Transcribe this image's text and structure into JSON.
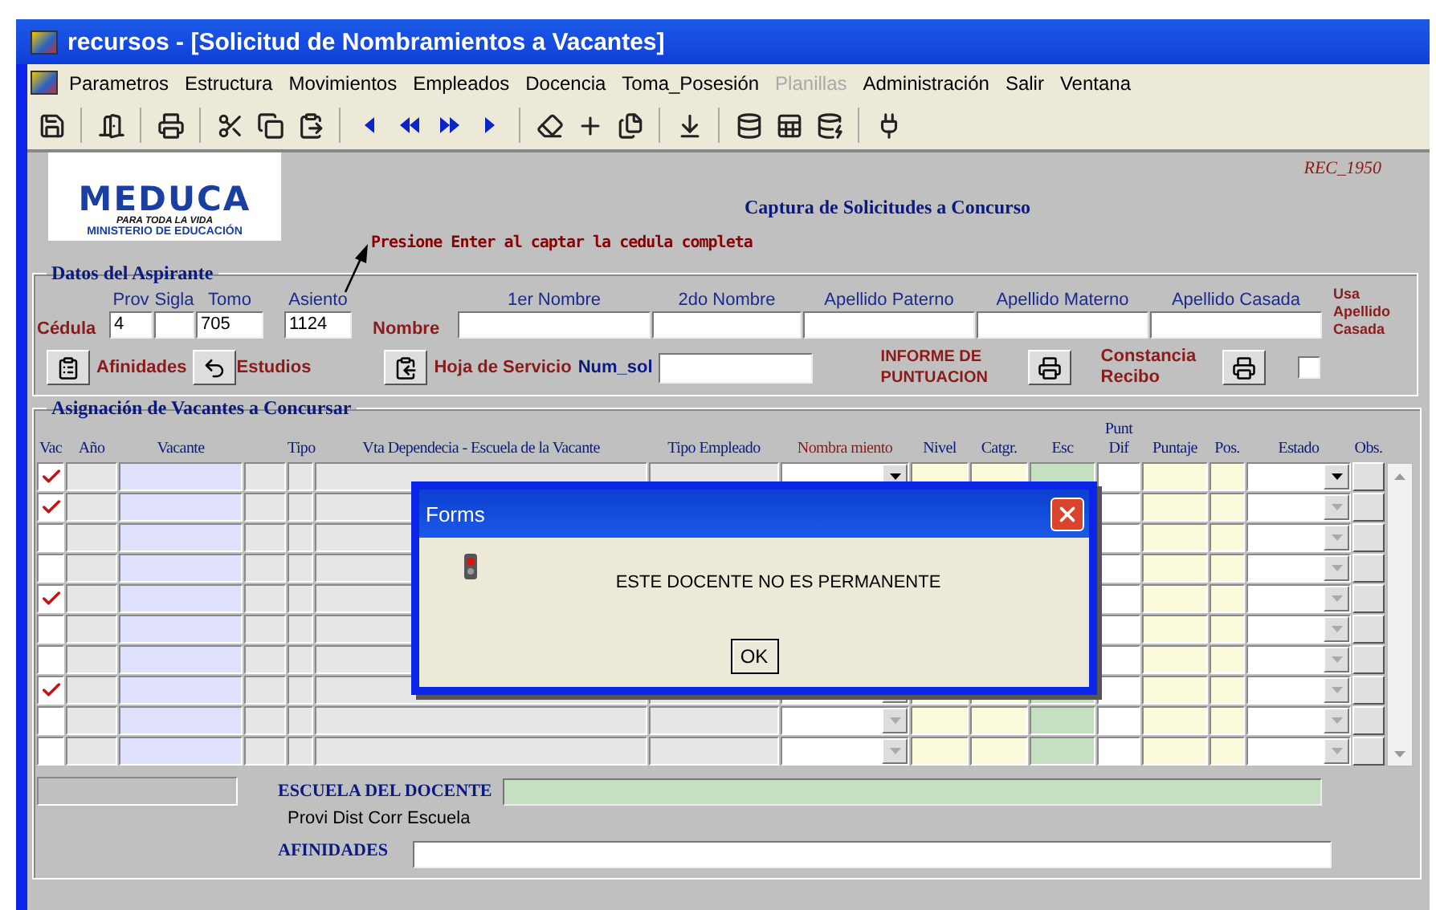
{
  "window": {
    "title": "recursos - [Solicitud de Nombramientos a Vacantes]"
  },
  "menu": [
    {
      "label": "Parametros",
      "disabled": false
    },
    {
      "label": "Estructura",
      "disabled": false
    },
    {
      "label": "Movimientos",
      "disabled": false
    },
    {
      "label": "Empleados",
      "disabled": false
    },
    {
      "label": "Docencia",
      "disabled": false
    },
    {
      "label": "Toma_Posesión",
      "disabled": false
    },
    {
      "label": "Planillas",
      "disabled": true
    },
    {
      "label": "Administración",
      "disabled": false
    },
    {
      "label": "Salir",
      "disabled": false
    },
    {
      "label": "Ventana",
      "disabled": false
    }
  ],
  "header": {
    "code": "REC_1950",
    "title": "Captura de Solicitudes a Concurso",
    "hint": "Presione Enter al captar la cedula completa",
    "logo": {
      "name": "MEDUCA",
      "tagline": "PARA TODA LA VIDA",
      "ministry": "MINISTERIO DE EDUCACIÓN"
    }
  },
  "aspirante": {
    "legend": "Datos del Aspirante",
    "cedula_label": "Cédula",
    "cedula": [
      {
        "label": "Prov",
        "value": "4"
      },
      {
        "label": "Sigla"
      },
      {
        "label": "Tomo",
        "value": "705"
      },
      {
        "label": "Asiento",
        "value": "1124"
      }
    ],
    "nombre_label": "Nombre",
    "name_fields": [
      {
        "label": "1er Nombre"
      },
      {
        "label": "2do Nombre"
      },
      {
        "label": "Apellido Paterno"
      },
      {
        "label": "Apellido Materno"
      },
      {
        "label": "Apellido Casada"
      }
    ],
    "usa_apellido_casada": {
      "label": "Usa Apellido Casada",
      "checked": false
    },
    "actions": [
      {
        "label": "Afinidades"
      },
      {
        "label": "Estudios"
      },
      {
        "label": "Hoja de Servicio"
      }
    ],
    "num_sol_label": "Num_sol",
    "reports": [
      {
        "label": "INFORME DE PUNTUACION"
      },
      {
        "label": "Constancia Recibo"
      }
    ]
  },
  "vacantes": {
    "legend": "Asignación de Vacantes a Concursar",
    "columns": [
      {
        "label": "Vac",
        "kind": "check",
        "color": "#0a1a80"
      },
      {
        "label": "Año",
        "kind": "gray",
        "color": "#0a1a80"
      },
      {
        "label": "Vacante",
        "kind": "lavender",
        "color": "#0a1a80"
      },
      {
        "kind": "gray"
      },
      {
        "label": "Tipo",
        "kind": "gray",
        "color": "#0a1a80"
      },
      {
        "label": "Vta Dependecia - Escuela de la Vacante",
        "kind": "gray",
        "color": "#0a1a80"
      },
      {
        "label": "Tipo Empleado",
        "kind": "gray",
        "color": "#0a1a80"
      },
      {
        "label": "Nombra miento",
        "kind": "dropdown",
        "color": "#8b1a1a"
      },
      {
        "label": "Nivel",
        "kind": "yellow",
        "color": "#0a1a80"
      },
      {
        "label": "Catgr.",
        "kind": "yellow",
        "color": "#0a1a80"
      },
      {
        "label": "Esc",
        "kind": "green",
        "color": "#0a1a80"
      },
      {
        "label": "Punt Dif",
        "kind": "white",
        "color": "#0a1a80"
      },
      {
        "label": "Puntaje",
        "kind": "yellow",
        "color": "#0a1a80"
      },
      {
        "label": "Pos.",
        "kind": "yellow",
        "color": "#0a1a80"
      },
      {
        "label": "Estado",
        "kind": "dropdown",
        "color": "#0a1a80"
      },
      {
        "label": "Obs.",
        "kind": "obs",
        "color": "#0a1a80"
      }
    ],
    "rows": [
      {
        "checked": true,
        "current": true
      },
      {
        "checked": true,
        "current": false
      },
      {
        "checked": false,
        "current": false
      },
      {
        "checked": false,
        "current": false
      },
      {
        "checked": true,
        "current": false
      },
      {
        "checked": false,
        "current": false
      },
      {
        "checked": false,
        "current": false
      },
      {
        "checked": true,
        "current": false
      },
      {
        "checked": false,
        "current": false
      },
      {
        "checked": false,
        "current": false
      }
    ]
  },
  "escuela": {
    "label": "ESCUELA DEL DOCENTE",
    "sublabel": "Provi Dist Corr Escuela"
  },
  "afinidades_label": "AFINIDADES",
  "dialog": {
    "title": "Forms",
    "message": "ESTE DOCENTE NO ES PERMANENTE",
    "button": "OK"
  }
}
